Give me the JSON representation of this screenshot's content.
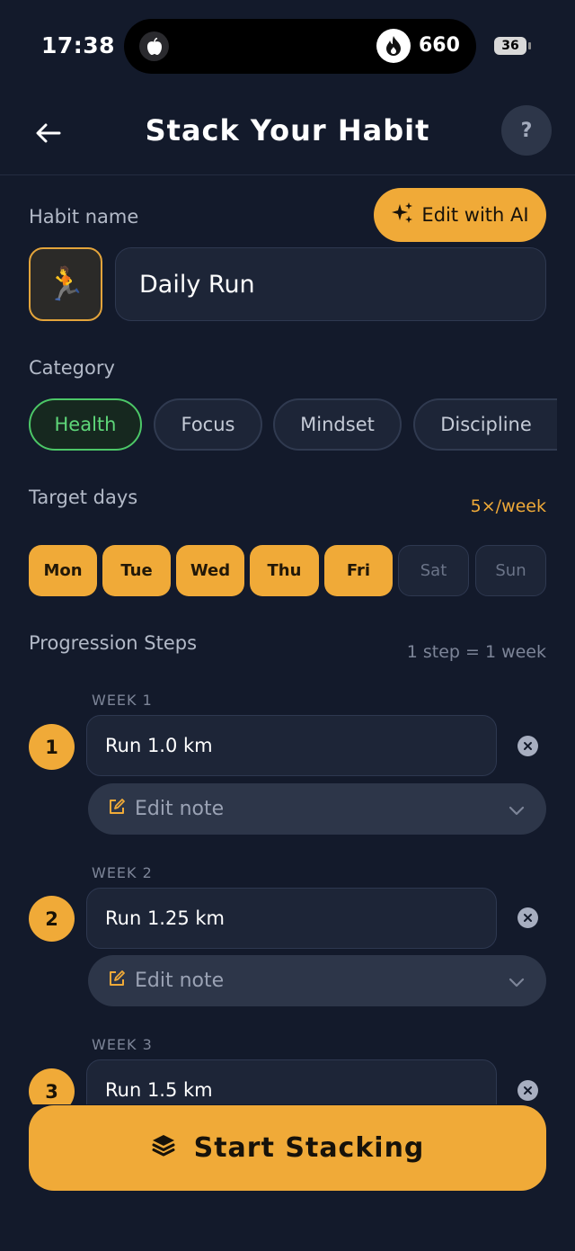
{
  "status_bar": {
    "time": "17:38",
    "streak_count": "660",
    "battery": "36"
  },
  "header": {
    "title": "Stack Your Habit",
    "help_label": "?"
  },
  "habit": {
    "label": "Habit name",
    "edit_ai_label": "Edit with AI",
    "emoji": "🏃",
    "name": "Daily Run"
  },
  "category": {
    "label": "Category",
    "chips": [
      "Health",
      "Focus",
      "Mindset",
      "Discipline"
    ],
    "selected": "Health"
  },
  "target_days": {
    "label": "Target days",
    "frequency": "5×/week",
    "days": [
      {
        "label": "Mon",
        "on": true
      },
      {
        "label": "Tue",
        "on": true
      },
      {
        "label": "Wed",
        "on": true
      },
      {
        "label": "Thu",
        "on": true
      },
      {
        "label": "Fri",
        "on": true
      },
      {
        "label": "Sat",
        "on": false
      },
      {
        "label": "Sun",
        "on": false
      }
    ]
  },
  "progression": {
    "label": "Progression Steps",
    "rule": "1 step = 1 week",
    "note_label": "Edit note",
    "steps": [
      {
        "week": "WEEK 1",
        "number": "1",
        "value": "Run 1.0 km"
      },
      {
        "week": "WEEK 2",
        "number": "2",
        "value": "Run 1.25 km"
      },
      {
        "week": "WEEK 3",
        "number": "3",
        "value": "Run 1.5 km"
      }
    ]
  },
  "cta": {
    "label": "Start Stacking"
  },
  "colors": {
    "background": "#131a2b",
    "accent": "#f0aa38",
    "success": "#4cc767"
  }
}
